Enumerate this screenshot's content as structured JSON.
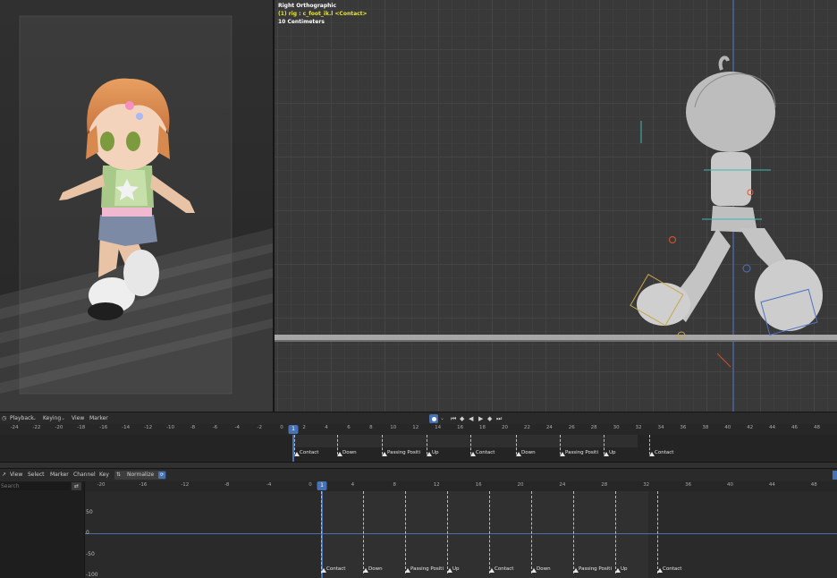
{
  "viewport_right": {
    "view_name": "Right Orthographic",
    "active_object": "(1) rig : c_foot_ik.l <Contact>",
    "scale_label": "10 Centimeters"
  },
  "timeline": {
    "menus": [
      "Playback",
      "Keying",
      "View",
      "Marker"
    ],
    "frame_ticks": [
      "-24",
      "-22",
      "-20",
      "-18",
      "-16",
      "-14",
      "-12",
      "-10",
      "-8",
      "-6",
      "-4",
      "-2",
      "0",
      "2",
      "4",
      "6",
      "8",
      "10",
      "12",
      "14",
      "16",
      "18",
      "20",
      "22",
      "24",
      "26",
      "28",
      "30",
      "32",
      "34",
      "36",
      "38",
      "40",
      "42",
      "44",
      "46",
      "48"
    ],
    "current_frame": "1",
    "markers": [
      "Contact",
      "Down",
      "Passing Positi",
      "Up",
      "Contact",
      "Down",
      "Passing Positi",
      "Up",
      "Contact"
    ]
  },
  "graph_editor": {
    "menus": [
      "View",
      "Select",
      "Marker",
      "Channel",
      "Key"
    ],
    "normalize_label": "Normalize",
    "search_placeholder": "Search",
    "frame_ticks": [
      "-20",
      "-16",
      "-12",
      "-8",
      "-4",
      "0",
      "4",
      "8",
      "12",
      "16",
      "20",
      "24",
      "28",
      "32",
      "36",
      "40",
      "44",
      "48"
    ],
    "current_frame": "1",
    "y_labels": [
      "50",
      "0",
      "-50",
      "-100"
    ],
    "markers": [
      "Contact",
      "Down",
      "Passing Positi",
      "Up",
      "Contact",
      "Down",
      "Passing Positi",
      "Up",
      "Contact"
    ]
  },
  "colors": {
    "accent": "#4772b3",
    "hud_yellow": "#e8e23a",
    "marker": "#e6e6e6"
  }
}
